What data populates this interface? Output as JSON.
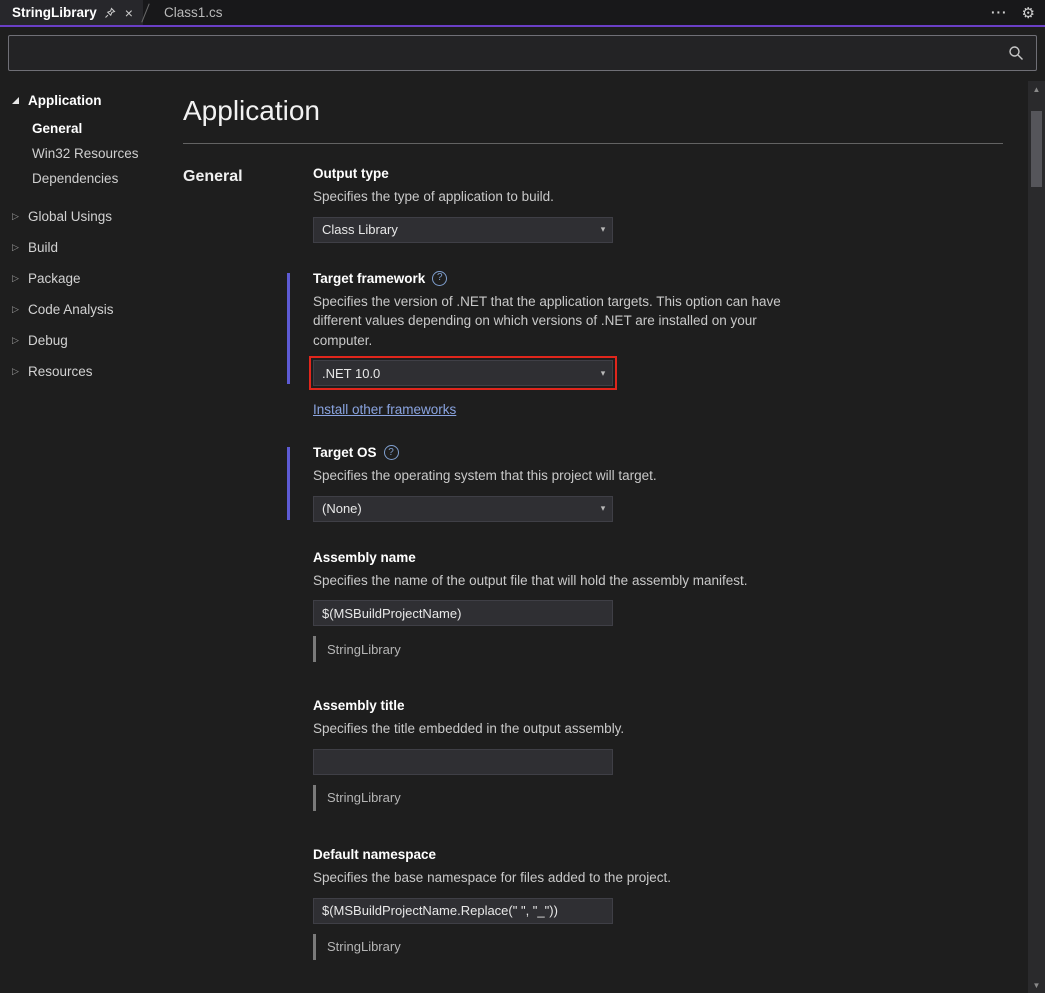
{
  "colors": {
    "accent_purple": "#6a3fc6",
    "modified_bar": "#5d5bd4",
    "highlight_red": "#e0261c",
    "link_blue": "#8aa4e0"
  },
  "icons": {
    "close": "×",
    "overflow": "···",
    "settings": "⚙",
    "dropdown": "▾",
    "collapsed": "▷",
    "scroll_up": "▲",
    "scroll_down": "▼",
    "help": "?"
  },
  "tabbar": {
    "tabs": [
      {
        "label": "StringLibrary"
      },
      {
        "label": "Class1.cs"
      }
    ]
  },
  "search": {
    "placeholder": ""
  },
  "sidebar": {
    "items": [
      {
        "label": "Application"
      },
      {
        "label": "General"
      },
      {
        "label": "Win32 Resources"
      },
      {
        "label": "Dependencies"
      },
      {
        "label": "Global Usings"
      },
      {
        "label": "Build"
      },
      {
        "label": "Package"
      },
      {
        "label": "Code Analysis"
      },
      {
        "label": "Debug"
      },
      {
        "label": "Resources"
      }
    ]
  },
  "main": {
    "title": "Application",
    "section_label": "General",
    "fields": [
      {
        "label": "Output type",
        "description": "Specifies the type of application to build.",
        "control": "dropdown",
        "value": "Class Library"
      },
      {
        "label": "Target framework",
        "description": "Specifies the version of .NET that the application targets. This option can have different values depending on which versions of .NET are installed on your computer.",
        "control": "dropdown",
        "value": ".NET 10.0",
        "highlighted": true,
        "modified": true,
        "link": "Install other frameworks"
      },
      {
        "label": "Target OS",
        "description": "Specifies the operating system that this project will target.",
        "control": "dropdown",
        "value": "(None)",
        "modified": true
      },
      {
        "label": "Assembly name",
        "description": "Specifies the name of the output file that will hold the assembly manifest.",
        "control": "input",
        "value": "$(MSBuildProjectName)",
        "evaluated": "StringLibrary"
      },
      {
        "label": "Assembly title",
        "description": "Specifies the title embedded in the output assembly.",
        "control": "input",
        "value": "",
        "evaluated": "StringLibrary"
      },
      {
        "label": "Default namespace",
        "description": "Specifies the base namespace for files added to the project.",
        "control": "input",
        "value": "$(MSBuildProjectName.Replace(\" \", \"_\"))",
        "highlighted": true,
        "evaluated": "StringLibrary"
      }
    ]
  }
}
